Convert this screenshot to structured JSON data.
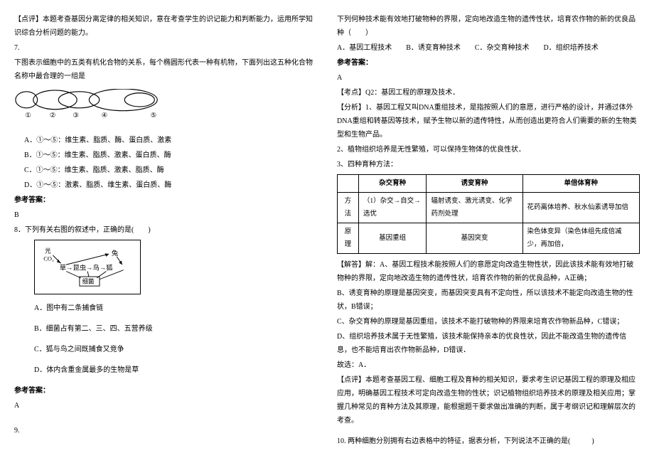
{
  "left": {
    "commentary6": "【点评】本题考查基因分离定律的相关知识，意在考查学生的识记能力和判断能力，运用所学知识综合分析问题的能力。",
    "q7_num": "7.",
    "q7_text": "下图表示细胞中的五类有机化合物的关系，每个椭圆形代表一种有机物，下面列出这五种化合物名称中最合理的一组是",
    "q7_labels": "①    ②    ③    ④            ⑤",
    "q7_a": "A．①～⑤：维生素、脂质、酶、蛋白质、激素",
    "q7_b": "B．①～⑤：维生素、脂质、激素、蛋白质、酶",
    "q7_c": "C．①～⑤：维生素、脂质、激素、脂质、酶",
    "q7_d": "D．①～⑤：激素、脂质、维生素、蛋白质、酶",
    "ref_lbl": "参考答案：",
    "q7_ans": "B",
    "q8_title": "8．下列有关右图的叙述中，正确的是(　　)",
    "diag_light": "光",
    "diag_co2": "CO₂",
    "diag_grass": "草→昆虫→鸟→狐",
    "diag_rabbit": "兔",
    "diag_bact": "细菌",
    "q8_a": "A．图中有二条捕食链",
    "q8_b": "B．细菌占有第二、三、四、五营养级",
    "q8_c": "C．狐与鸟之间既捕食又竞争",
    "q8_d": "D．体内含重金属最多的生物是草",
    "q8_ans": "A",
    "q9_num": "9."
  },
  "right": {
    "q9_text": "下列何种技术能有效地打破物种的界限，定向地改造生物的遗传性状，培育农作物的新的优良品种（　　）",
    "q9_opts": "A．基因工程技术　　B．诱变育种技术　　C．杂交育种技术　　D．组织培养技术",
    "ref_lbl": "参考答案：",
    "q9_ans": "A",
    "kp": "【考点】Q2：基因工程的原理及技术．",
    "an1": "【分析】1、基因工程又叫DNA重组技术，是指按照人们的意愿，进行严格的设计，并通过体外DNA重组和转基因等技术，赋予生物以新的遗传特性，从而创造出更符合人们需要的新的生物类型和生物产品。",
    "an2": "2、植物组织培养是无性繁殖，可以保持生物体的优良性状．",
    "an3": "3、四种育种方法：",
    "table": {
      "h1": "",
      "h2": "杂交育种",
      "h3": "诱变育种",
      "h4": "单倍体育种",
      "r1c1": "方法",
      "r1c2": "（1）杂交→自交→选优",
      "r1c3": "辐射诱变、激光诱变、化学药剂处理",
      "r1c4": "花药离体培养、秋水仙素诱导加倍",
      "r2c1": "原理",
      "r2c2": "基因重组",
      "r2c3": "基因突变",
      "r2c4": "染色体变异（染色体组先成倍减少，再加倍，"
    },
    "sol1": "【解答】解：A、基因工程技术能按照人们的意愿定向改造生物性状，因此该技术能有效地打破物种的界限，定向地改造生物的遗传性状，培育农作物的新的优良品种，A正确；",
    "sol2": "B、诱变育种的原理是基因突变，而基因突变具有不定向性，所以该技术不能定向改造生物的性状，B错误；",
    "sol3": "C、杂交育种的原理是基因重组，该技术不能打破物种的界限来培育农作物新品种，C错误；",
    "sol4": "D、组织培养技术属于无性繁殖，该技术能保持亲本的优良性状，因此不能改造生物的遗传信息，也不能培育出农作物新品种，D错误．",
    "sol5": "故选：A．",
    "cmt": "【点评】本题考查基因工程、细胞工程及育种的相关知识，要求考生识记基因工程的原理及相应应用，明确基因工程技术可定向改造生物的性状；识记植物组织培养技术的原理及相关应用；掌握几种常见的育种方法及其原理，能根据题干要求做出准确的判断，属于考纲识记和理解层次的考查。",
    "q10": "10. 两种细胞分别拥有右边表格中的特征，据表分析，下列说法不正确的是(　　　)"
  }
}
